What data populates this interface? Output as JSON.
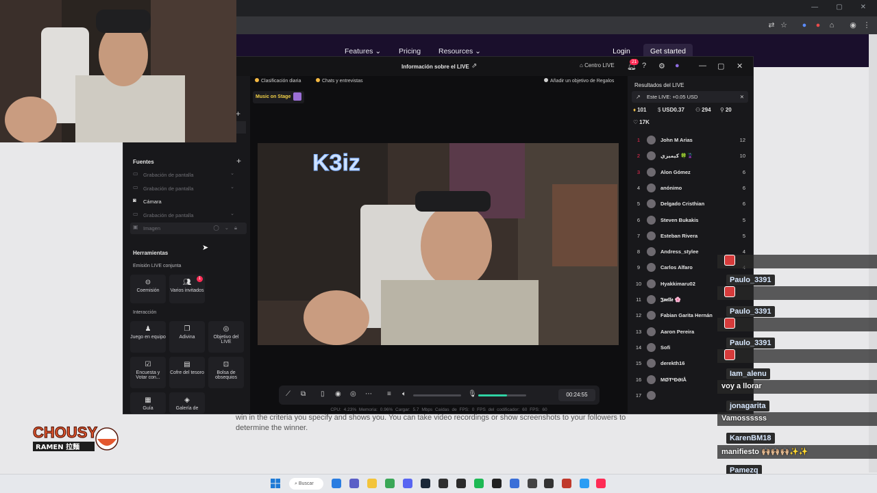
{
  "browser": {
    "nav": {
      "features": "Features",
      "pricing": "Pricing",
      "resources": "Resources",
      "login": "Login",
      "get_started": "Get started"
    },
    "body_text": "win in the criteria you specify and shows you. You can take video recordings or show screenshots to your followers to determine the winner."
  },
  "app": {
    "title": "Información sobre el LIVE",
    "centro_live": "Centro LIVE",
    "notif_count": "21",
    "chips": {
      "daily": "Clasificación diaria",
      "chats": "Chats y entrevistas",
      "goal": "Añadir un objetivo de Regalos"
    },
    "music_tag": "Music on Stage",
    "left": {
      "sources_title": "Fuentes",
      "sources": [
        {
          "label": "Grabación de pantalla"
        },
        {
          "label": "Grabación de pantalla"
        },
        {
          "label": "Cámara"
        },
        {
          "label": "Grabación de pantalla"
        },
        {
          "label": "Imagen"
        }
      ],
      "tools_title": "Herramientas",
      "co_live_title": "Emisión LIVE conjunta",
      "co_live": [
        {
          "label": "Coemisión"
        },
        {
          "label": "Varios invitados",
          "badge": "1"
        }
      ],
      "interaction_title": "Interacción",
      "interaction": [
        {
          "label": "Juego en equipo"
        },
        {
          "label": "Adivina"
        },
        {
          "label": "Objetivo del LIVE"
        },
        {
          "label": "Encuesta y Votar con..."
        },
        {
          "label": "Cofre del tesoro"
        },
        {
          "label": "Bolsa de obsequios"
        },
        {
          "label": "Guía"
        },
        {
          "label": "Galería de"
        }
      ]
    },
    "controls": {
      "timer": "00:24:55",
      "volume_level": 0.0,
      "mic_level": 0.6
    },
    "stats_line": "CPU: 4.23%   Memoria: 0.96%   Cargar: 5.7 Mbps   Caídas de FPS: 0   FPS del codificador: 60   FPS: 60",
    "right": {
      "title": "Resultados del LIVE",
      "earnings": "Este LIVE: +0.05 USD",
      "stats": {
        "diamonds": "101",
        "usd": "USD0.37",
        "viewers": "294",
        "new_followers": "20",
        "likes": "17K"
      },
      "ranking": [
        {
          "rank": "1",
          "name": "John M Arias",
          "score": "12"
        },
        {
          "rank": "2",
          "name": "كيميزي 🍀🦹",
          "score": "10"
        },
        {
          "rank": "3",
          "name": "Alon Gómez",
          "score": "6"
        },
        {
          "rank": "4",
          "name": "anónimo",
          "score": "6"
        },
        {
          "rank": "5",
          "name": "Delgado Cristhian",
          "score": "6"
        },
        {
          "rank": "6",
          "name": "Steven Bukakis",
          "score": "5"
        },
        {
          "rank": "7",
          "name": "Esteban Rivera",
          "score": "5"
        },
        {
          "rank": "8",
          "name": "Andress_stylee",
          "score": "4"
        },
        {
          "rank": "9",
          "name": "Carlos Alfaro",
          "score": "4"
        },
        {
          "rank": "10",
          "name": "Hyakkimaru02",
          "score": ""
        },
        {
          "rank": "11",
          "name": "𝕵𝖔𝖊𝖑𝖑𝖊 🌸",
          "score": ""
        },
        {
          "rank": "12",
          "name": "Fabian Garita Hernán",
          "score": ""
        },
        {
          "rank": "13",
          "name": "Aaron Pereira",
          "score": ""
        },
        {
          "rank": "14",
          "name": "Sofi",
          "score": ""
        },
        {
          "rank": "15",
          "name": "derekth16",
          "score": ""
        },
        {
          "rank": "16",
          "name": "MØŦ*ÐƏIÅ",
          "score": ""
        },
        {
          "rank": "17",
          "name": "",
          "score": ""
        }
      ]
    }
  },
  "logo": {
    "line1": "CHOUSY",
    "line2": "RAMEN 拉麵"
  },
  "chat": [
    {
      "user": "Paulo_3391",
      "msg": ""
    },
    {
      "user": "Paulo_3391",
      "msg": ""
    },
    {
      "user": "Paulo_3391",
      "msg": ""
    },
    {
      "user": "Iam_alenu",
      "msg": "voy a llorar"
    },
    {
      "user": "jonagarita",
      "msg": "Vamossssss"
    },
    {
      "user": "KarenBM18",
      "msg": "manifiesto 🙌🏼🙌🏼🙌🏼✨✨"
    },
    {
      "user": "Pamezq",
      "msg": ""
    }
  ],
  "taskbar": {
    "search": "Buscar"
  }
}
